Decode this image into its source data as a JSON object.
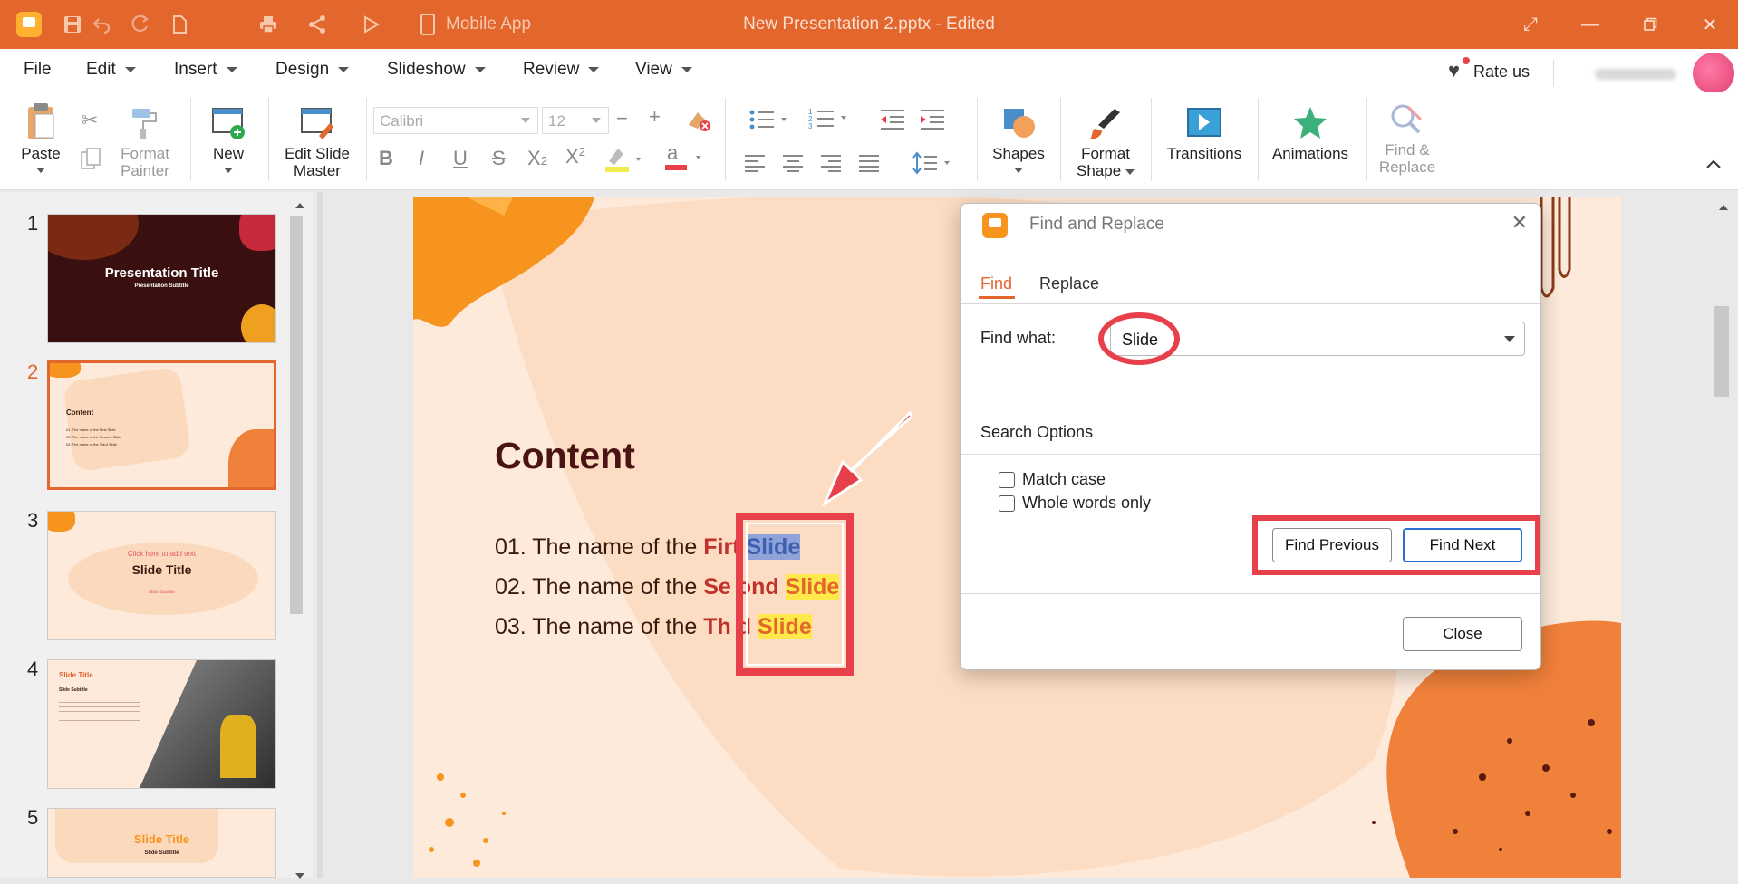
{
  "window": {
    "title": "New Presentation 2.pptx - Edited",
    "mobile_app_label": "Mobile App"
  },
  "menu": {
    "items": [
      {
        "label": "File",
        "has_caret": false
      },
      {
        "label": "Edit",
        "has_caret": true
      },
      {
        "label": "Insert",
        "has_caret": true
      },
      {
        "label": "Design",
        "has_caret": true
      },
      {
        "label": "Slideshow",
        "has_caret": true
      },
      {
        "label": "Review",
        "has_caret": true
      },
      {
        "label": "View",
        "has_caret": true
      }
    ],
    "rate_us": "Rate us"
  },
  "ribbon": {
    "paste": "Paste",
    "format_painter_1": "Format",
    "format_painter_2": "Painter",
    "new": "New",
    "edit_slide_master_1": "Edit Slide",
    "edit_slide_master_2": "Master",
    "font_name": "Calibri",
    "font_size": "12",
    "shapes": "Shapes",
    "format_shape_1": "Format",
    "format_shape_2": "Shape",
    "transitions": "Transitions",
    "animations": "Animations",
    "find_replace_1": "Find &",
    "find_replace_2": "Replace"
  },
  "thumbnails": [
    {
      "num": "1",
      "title": "Presentation Title",
      "subtitle": "Presentation Subtitle"
    },
    {
      "num": "2",
      "title": "Content",
      "rows": [
        "01. The name of the First Slide",
        "02. The name of the Second Slide",
        "03. The name of the Third Slide"
      ]
    },
    {
      "num": "3",
      "title": "Slide Title",
      "pre": "Click here to add text",
      "subtitle": "Slide Subtitle"
    },
    {
      "num": "4",
      "title": "Slide Title",
      "subtitle": "Slide Subtitle"
    },
    {
      "num": "5",
      "title": "Slide Title",
      "subtitle": "Slide Subtitle"
    }
  ],
  "slide": {
    "heading": "Content",
    "lines": [
      {
        "prefix": "01. The name of the ",
        "bold": "Fir",
        "rest": "t",
        "match": "Slide"
      },
      {
        "prefix": "02. The name of the ",
        "bold": "Se",
        "rest": "ond",
        "match": "Slide"
      },
      {
        "prefix": "03. The name of the ",
        "bold": "Th",
        "rest": "d",
        "match": "Slide"
      }
    ]
  },
  "dialog": {
    "title": "Find and Replace",
    "tabs": [
      "Find",
      "Replace"
    ],
    "active_tab": "Find",
    "find_what_label": "Find what:",
    "find_what_value": "Slide",
    "search_options_label": "Search Options",
    "match_case": "Match case",
    "whole_words": "Whole words only",
    "find_previous": "Find Previous",
    "find_next": "Find Next",
    "close": "Close"
  },
  "colors": {
    "accent": "#e3662c",
    "annotation": "#e8404a"
  }
}
